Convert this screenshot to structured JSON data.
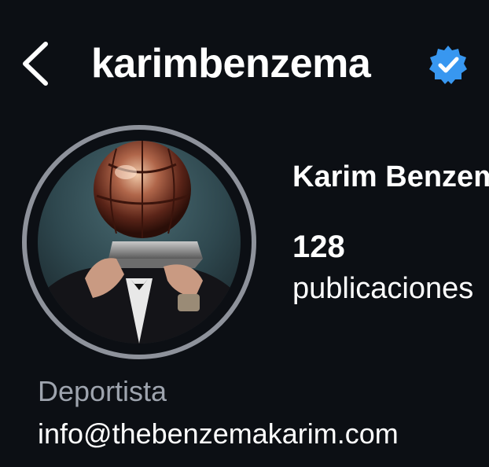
{
  "header": {
    "back_icon": "chevron-left-icon",
    "username": "karimbenzema",
    "verified_icon": "verified-badge-icon",
    "verified_color": "#3897f0"
  },
  "profile": {
    "avatar_description": "profile-photo",
    "avatar_ring_color": "#8e929b",
    "full_name": "Karim Benzema",
    "posts_count": "128",
    "posts_label": "publicaciones",
    "category": "Deportista",
    "email": "info@thebenzemakarim.com"
  },
  "theme": {
    "background": "#0c0f14",
    "text_primary": "#ffffff",
    "text_secondary": "#9ea4ae"
  }
}
